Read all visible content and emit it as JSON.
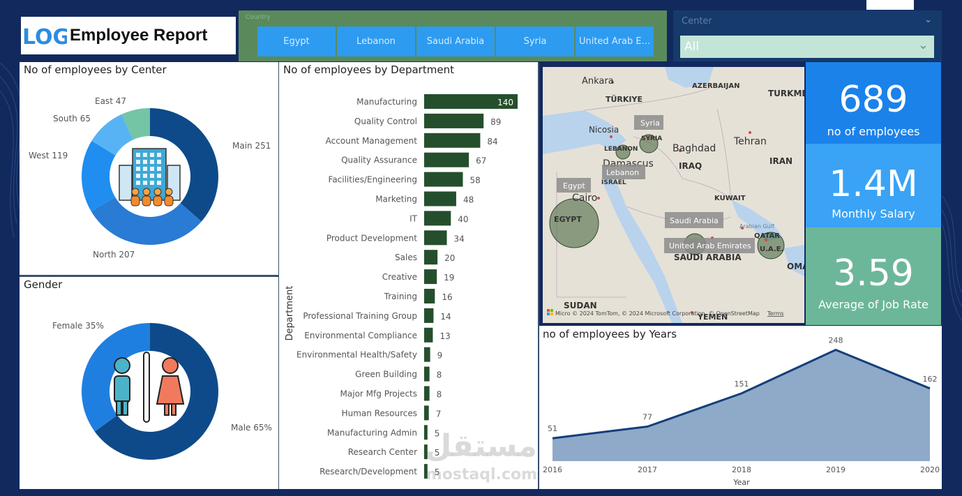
{
  "header": {
    "logo": "LOGO",
    "title": "Employee Report"
  },
  "country_slicer": {
    "caption": "Country",
    "options": [
      "Egypt",
      "Lebanon",
      "Saudi Arabia",
      "Syria",
      "United Arab E..."
    ]
  },
  "center_slicer": {
    "label": "Center",
    "value": "All"
  },
  "center_chart": {
    "title": "No of employees by Center",
    "type": "donut",
    "slices": [
      {
        "name": "Main",
        "value": 251,
        "label": "Main 251",
        "color": "#0e4a8a"
      },
      {
        "name": "North",
        "value": 207,
        "label": "North 207",
        "color": "#2a7bd4"
      },
      {
        "name": "West",
        "value": 119,
        "label": "West 119",
        "color": "#1f8ef0"
      },
      {
        "name": "South",
        "value": 65,
        "label": "South 65",
        "color": "#58b3f5"
      },
      {
        "name": "East",
        "value": 47,
        "label": "East 47",
        "color": "#74c4a6"
      }
    ]
  },
  "gender_chart": {
    "title": "Gender",
    "type": "donut",
    "slices": [
      {
        "name": "Male",
        "value": 65,
        "label": "Male 65%",
        "color": "#0e4a8a"
      },
      {
        "name": "Female",
        "value": 35,
        "label": "Female 35%",
        "color": "#1f7fe0"
      }
    ]
  },
  "department_chart": {
    "title": "No of employees by Department",
    "axis_label": "Department",
    "bar_color": "#254f2c"
  },
  "map": {
    "labels": [
      "Ankara",
      "TÜRKIYE",
      "AZERBAIJAN",
      "TURKME",
      "Nicosia",
      "LEBANON",
      "Damascus",
      "Baghdad",
      "IRAQ",
      "Tehran",
      "IRAN",
      "ISRAEL",
      "KUWAIT",
      "QATAR",
      "Arabian Gulf",
      "U.A.E.",
      "OMA",
      "SAUDI ARABIA",
      "Cairo",
      "EGYPT",
      "SUDAN",
      "YEMEN",
      "SYRIA"
    ],
    "tooltips": [
      "Syria",
      "Lebanon",
      "Egypt",
      "Saudi Arabia",
      "United Arab Emirates"
    ],
    "attribution": "Micro © 2024 TomTom, © 2024 Microsoft Corporation, © OpenStreetMap",
    "terms": "Terms"
  },
  "kpis": [
    {
      "value": "689",
      "label": "no of employees",
      "color": "#1b82ea"
    },
    {
      "value": "1.4M",
      "label": "Monthly Salary",
      "color": "#3aa3f5"
    },
    {
      "value": "3.59",
      "label": "Average of Job Rate",
      "color": "#6cb79a"
    }
  ],
  "years_chart": {
    "title": "no of employees by Years",
    "xlabel": "Year"
  },
  "watermark": {
    "arabic": "مستقل",
    "latin": "mostaql.com"
  },
  "chart_data": [
    {
      "type": "bar",
      "title": "No of employees by Department",
      "ylabel": "Department",
      "categories": [
        "Manufacturing",
        "Quality Control",
        "Account Management",
        "Quality Assurance",
        "Facilities/Engineering",
        "Marketing",
        "IT",
        "Product Development",
        "Sales",
        "Creative",
        "Training",
        "Professional Training Group",
        "Environmental Compliance",
        "Environmental Health/Safety",
        "Green Building",
        "Major Mfg Projects",
        "Human Resources",
        "Manufacturing Admin",
        "Research Center",
        "Research/Development"
      ],
      "values": [
        140,
        89,
        84,
        67,
        58,
        48,
        40,
        34,
        20,
        19,
        16,
        14,
        13,
        9,
        8,
        8,
        7,
        5,
        5,
        5
      ]
    },
    {
      "type": "area",
      "title": "no of employees by Years",
      "xlabel": "Year",
      "x": [
        "2016",
        "2017",
        "2018",
        "2019",
        "2020"
      ],
      "values": [
        51,
        77,
        151,
        248,
        162
      ]
    }
  ]
}
